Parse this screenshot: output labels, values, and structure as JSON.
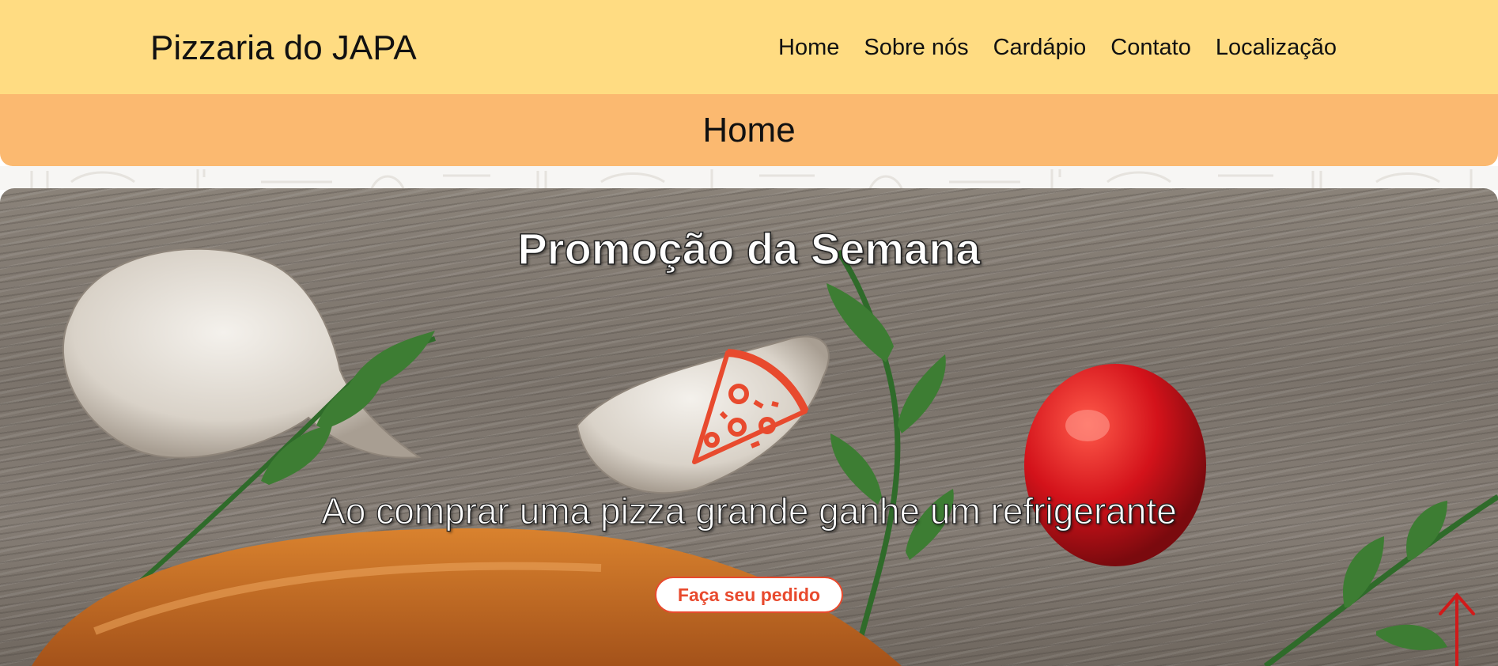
{
  "header": {
    "brand": "Pizzaria do JAPA",
    "nav": [
      "Home",
      "Sobre nós",
      "Cardápio",
      "Contato",
      "Localização"
    ]
  },
  "page_banner": {
    "title": "Home"
  },
  "hero": {
    "title": "Promoção da Semana",
    "text": "Ao comprar uma pizza grande ganhe um refrigerante",
    "button_label": "Faça seu pedido",
    "icon": "pizza-slice-icon"
  },
  "scroll_top": {
    "icon": "arrow-up-icon"
  },
  "colors": {
    "header_bg": "#ffdc82",
    "banner_bg": "#fbb970",
    "accent": "#e84a2e"
  }
}
